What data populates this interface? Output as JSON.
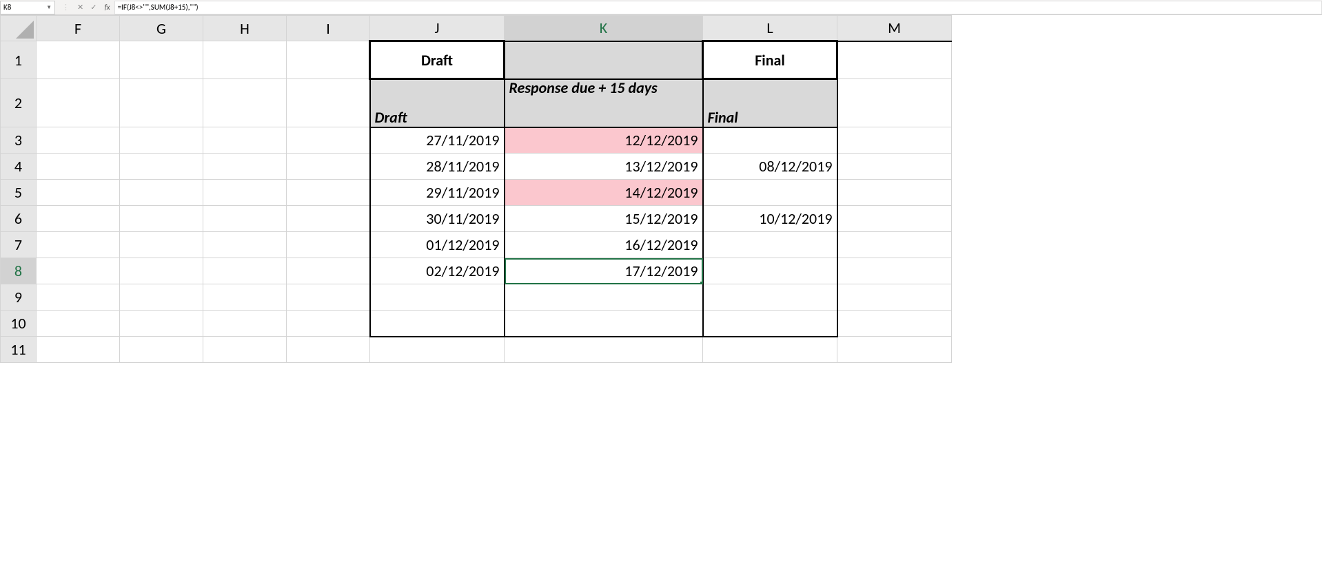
{
  "formula_bar": {
    "cell_ref": "K8",
    "fx_label": "fx",
    "formula": "=IF(J8<>\"\",SUM(J8+15),\"\")"
  },
  "columns": {
    "F": "F",
    "G": "G",
    "H": "H",
    "I": "I",
    "J": "J",
    "K": "K",
    "L": "L",
    "M": "M"
  },
  "rows": {
    "1": "1",
    "2": "2",
    "3": "3",
    "4": "4",
    "5": "5",
    "6": "6",
    "7": "7",
    "8": "8",
    "9": "9",
    "10": "10",
    "11": "11"
  },
  "headers": {
    "J1": "Draft",
    "L1": "Final",
    "J2": "Draft",
    "K2": "Response due + 15 days",
    "L2": "Final"
  },
  "data": {
    "J3": "27/11/2019",
    "K3": "12/12/2019",
    "L3": "",
    "J4": "28/11/2019",
    "K4": "13/12/2019",
    "L4": "08/12/2019",
    "J5": "29/11/2019",
    "K5": "14/12/2019",
    "L5": "",
    "J6": "30/11/2019",
    "K6": "15/12/2019",
    "L6": "10/12/2019",
    "J7": "01/12/2019",
    "K7": "16/12/2019",
    "L7": "",
    "J8": "02/12/2019",
    "K8": "17/12/2019",
    "L8": ""
  },
  "highlight": {
    "K3": true,
    "K5": true
  },
  "active_cell": "K8"
}
